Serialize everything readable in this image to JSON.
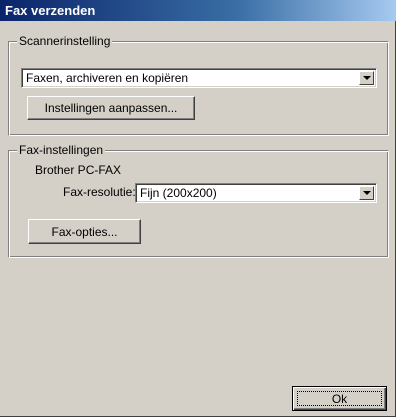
{
  "window": {
    "title": "Fax verzenden"
  },
  "scanner_group": {
    "legend": "Scannerinstelling",
    "dropdown_value": "Faxen, archiveren en kopiëren",
    "settings_button": "Instellingen aanpassen..."
  },
  "fax_group": {
    "legend": "Fax-instellingen",
    "device_name": "Brother PC-FAX",
    "resolution_label": "Fax-resolutie:",
    "resolution_value": "Fijn (200x200)",
    "options_button": "Fax-opties..."
  },
  "footer": {
    "ok_button": "Ok"
  },
  "icons": [
    "chevron-down-icon"
  ]
}
